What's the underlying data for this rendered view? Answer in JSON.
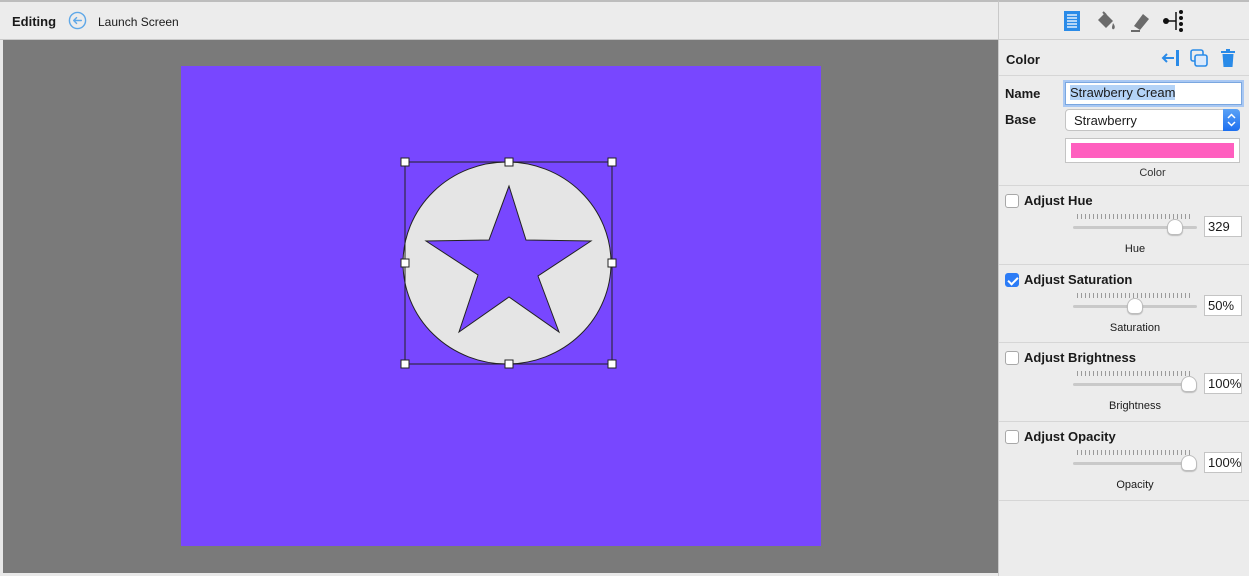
{
  "toolbar": {
    "mode_label": "Editing",
    "breadcrumb": "Launch Screen",
    "back_icon": "circle-arrow-left-icon"
  },
  "canvas": {
    "artboard_color": "#7847ff",
    "shape_fill": "#e5e5e5",
    "background_color": "#7a7a7a"
  },
  "inspector": {
    "tabs": [
      "list-icon",
      "paint-bucket-icon",
      "eraser-icon",
      "node-tree-icon"
    ],
    "section_title": "Color",
    "header_icons": [
      "import-icon",
      "duplicate-icon",
      "trash-icon"
    ],
    "name_label": "Name",
    "name_value": "Strawberry Cream",
    "base_label": "Base",
    "base_value": "Strawberry",
    "color_caption": "Color",
    "swatch_color": "#ff5fbf",
    "adjustments": [
      {
        "title": "Adjust Hue",
        "checked": false,
        "value": "329",
        "caption": "Hue",
        "level": 0.87
      },
      {
        "title": "Adjust Saturation",
        "checked": true,
        "value": "50%",
        "caption": "Saturation",
        "level": 0.5
      },
      {
        "title": "Adjust Brightness",
        "checked": false,
        "value": "100%",
        "caption": "Brightness",
        "level": 1.0
      },
      {
        "title": "Adjust Opacity",
        "checked": false,
        "value": "100%",
        "caption": "Opacity",
        "level": 1.0
      }
    ]
  }
}
